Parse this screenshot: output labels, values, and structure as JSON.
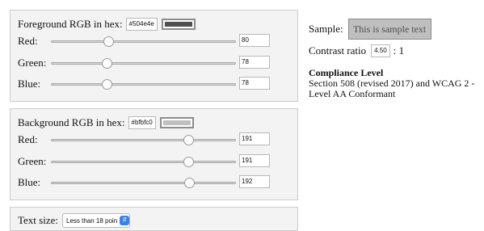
{
  "foreground": {
    "label": "Foreground RGB in hex:",
    "hex": "#504e4e",
    "swatch_color": "#504e4e",
    "channels": [
      {
        "label": "Red:",
        "value": 80
      },
      {
        "label": "Green:",
        "value": 78
      },
      {
        "label": "Blue:",
        "value": 78
      }
    ]
  },
  "background": {
    "label": "Background RGB in hex:",
    "hex": "#bfbfc0",
    "swatch_color": "#bfbfc0",
    "channels": [
      {
        "label": "Red:",
        "value": 191
      },
      {
        "label": "Green:",
        "value": 191
      },
      {
        "label": "Blue:",
        "value": 192
      }
    ]
  },
  "text_size": {
    "label": "Text size:",
    "selected": "Less than 18 poin"
  },
  "sample": {
    "label": "Sample:",
    "text": "This is sample text",
    "fg_color": "#504e4e",
    "bg_color": "#bfbfc0"
  },
  "contrast": {
    "label": "Contrast ratio",
    "value": "4.50",
    "suffix": ": 1"
  },
  "compliance": {
    "heading": "Compliance Level",
    "text": "Section 508 (revised 2017) and WCAG 2 - Level AA Conformant"
  },
  "slider_max": 255,
  "colors": {
    "panel_bg": "#f3f3f3",
    "select_arrow": "#3b82e8"
  }
}
